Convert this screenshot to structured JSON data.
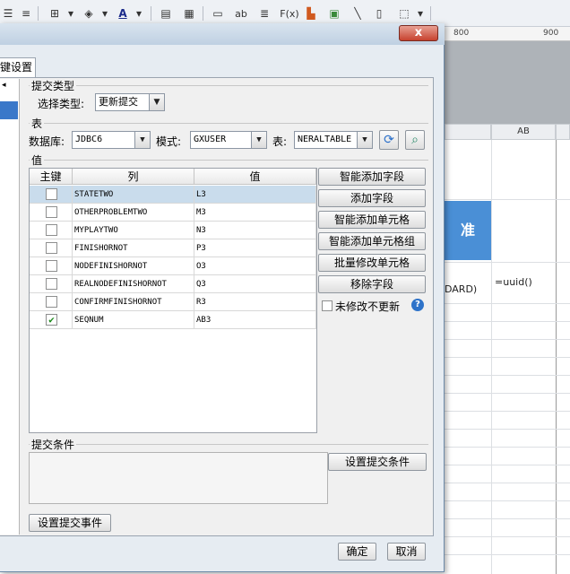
{
  "background_app": {
    "ruler_marks": [
      "800",
      "900"
    ],
    "column_header": "AB",
    "blue_cell_text": "准",
    "cell_text_left": "DARD)",
    "cell_formula": "=uuid()"
  },
  "dialog": {
    "close_label": "x",
    "tab_label": "键设置",
    "submit_type": {
      "legend": "提交类型",
      "select_label": "选择类型:",
      "select_value": "更新提交"
    },
    "table_section": {
      "legend": "表",
      "database_label": "数据库:",
      "database_value": "JDBC6",
      "mode_label": "模式:",
      "mode_value": "GXUSER",
      "table_label": "表:",
      "table_value": "NERALTABLE"
    },
    "values_section": {
      "legend": "值",
      "columns": [
        "主键",
        "列",
        "值"
      ],
      "rows": [
        {
          "key": false,
          "column": "STATETWO",
          "value": "L3",
          "selected": true
        },
        {
          "key": false,
          "column": "OTHERPROBLEMTWO",
          "value": "M3"
        },
        {
          "key": false,
          "column": "MYPLAYTWO",
          "value": "N3"
        },
        {
          "key": false,
          "column": "FINISHORNOT",
          "value": "P3"
        },
        {
          "key": false,
          "column": "NODEFINISHORNOT",
          "value": "O3"
        },
        {
          "key": false,
          "column": "REALNODEFINISHORNOT",
          "value": "Q3"
        },
        {
          "key": false,
          "column": "CONFIRMFINISHORNOT",
          "value": "R3"
        },
        {
          "key": true,
          "column": "SEQNUM",
          "value": "AB3"
        }
      ],
      "buttons": {
        "smart_add_field": "智能添加字段",
        "add_field": "添加字段",
        "smart_add_cell": "智能添加单元格",
        "smart_add_cell_group": "智能添加单元格组",
        "batch_edit_cell": "批量修改单元格",
        "remove_field": "移除字段"
      },
      "unchanged_checkbox_label": "未修改不更新"
    },
    "submit_condition": {
      "legend": "提交条件",
      "set_button": "设置提交条件"
    },
    "set_event_button": "设置提交事件",
    "ok_button": "确定",
    "cancel_button": "取消"
  }
}
